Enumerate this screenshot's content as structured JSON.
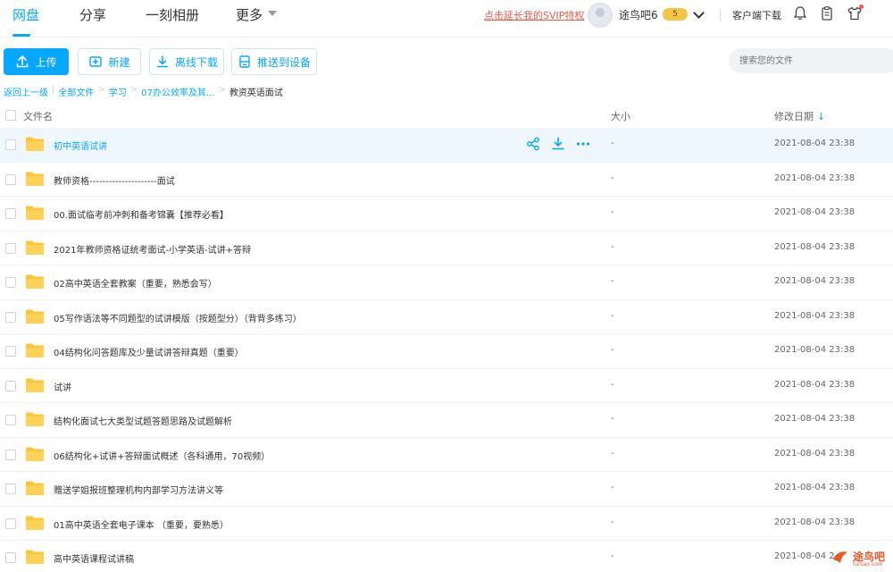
{
  "nav": {
    "tabs": [
      "网盘",
      "分享",
      "一刻相册",
      "更多"
    ],
    "svip_link": "点击延长我的SVIP特权",
    "username": "途鸟吧6",
    "vip_level": "5",
    "client_download": "客户端下载"
  },
  "toolbar": {
    "upload": "上传",
    "new": "新建",
    "offline_download": "离线下载",
    "push_to_device": "推送到设备",
    "search_placeholder": "搜索您的文件"
  },
  "breadcrumb": {
    "back": "返回上一级",
    "items": [
      "全部文件",
      "学习",
      "07办公效率及其..."
    ],
    "current": "教资英语面试"
  },
  "table": {
    "headers": {
      "name": "文件名",
      "size": "大小",
      "modified": "修改日期"
    },
    "rows": [
      {
        "name": "初中英语试讲",
        "size": "-",
        "date": "2021-08-04 23:38"
      },
      {
        "name": "教师资格---------------------面试",
        "size": "-",
        "date": "2021-08-04 23:38"
      },
      {
        "name": "00.面试临考前冲刺和备考锦囊【推荐必看】",
        "size": "-",
        "date": "2021-08-04 23:38"
      },
      {
        "name": "2021年教师资格证统考面试-小学英语-试讲+答辩",
        "size": "-",
        "date": "2021-08-04 23:38"
      },
      {
        "name": "02高中英语全套教案（重要，熟悉会写）",
        "size": "-",
        "date": "2021-08-04 23:38"
      },
      {
        "name": "05写作语法等不同题型的试讲模版（按题型分）（背背多练习）",
        "size": "-",
        "date": "2021-08-04 23:38"
      },
      {
        "name": "04结构化问答题库及少量试讲答辩真题（重要）",
        "size": "-",
        "date": "2021-08-04 23:38"
      },
      {
        "name": "试讲",
        "size": "-",
        "date": "2021-08-04 23:38"
      },
      {
        "name": "结构化面试七大类型试题答题思路及试题解析",
        "size": "-",
        "date": "2021-08-04 23:38"
      },
      {
        "name": "06结构化+试讲+答辩面试概述（各科通用，70视频）",
        "size": "-",
        "date": "2021-08-04 23:38"
      },
      {
        "name": "赠送学姐报班整理机构内部学习方法讲义等",
        "size": "-",
        "date": "2021-08-04 23:38"
      },
      {
        "name": "01高中英语全套电子课本 （重要，要熟悉）",
        "size": "-",
        "date": "2021-08-04 23:38"
      },
      {
        "name": "高中英语课程试讲稿",
        "size": "-",
        "date": "2021-08-04 2"
      }
    ]
  },
  "watermark": {
    "text": "途鸟吧",
    "sub": "tuniao.com"
  },
  "colors": {
    "accent": "#06a7ff",
    "folder": "#ffc533",
    "svip": "#f25a4a"
  }
}
